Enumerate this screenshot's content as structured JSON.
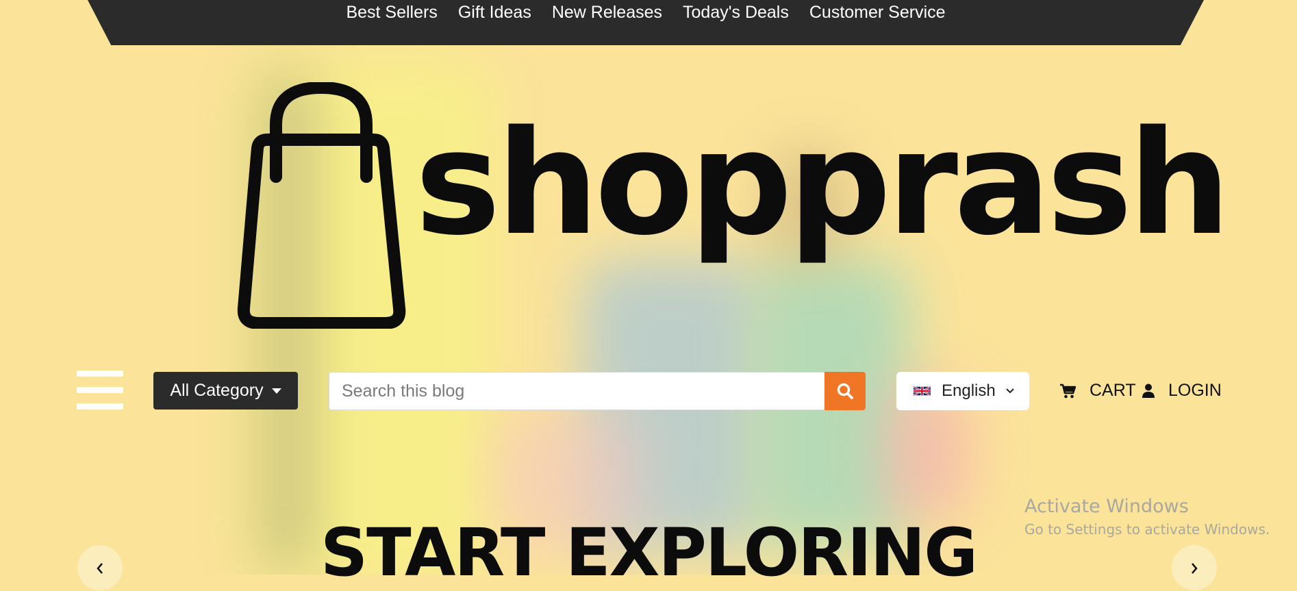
{
  "top_nav": {
    "items": [
      "Best Sellers",
      "Gift Ideas",
      "New Releases",
      "Today's Deals",
      "Customer Service"
    ]
  },
  "brand": {
    "logo_text": "shopprash"
  },
  "header": {
    "category_label": "All Category",
    "search_placeholder": "Search this blog",
    "language": "English",
    "cart_label": "CART",
    "login_label": "LOGIN"
  },
  "hero": {
    "title": "START EXPLORING"
  },
  "watermark": {
    "line1": "Activate Windows",
    "line2": "Go to Settings to activate Windows."
  },
  "colors": {
    "background": "#fbe39a",
    "nav_bg": "#2b2b2b",
    "accent": "#f07524"
  },
  "icons": [
    "menu-icon",
    "search-icon",
    "uk-flag-icon",
    "chevron-down-icon",
    "cart-icon",
    "user-icon",
    "chevron-left-icon",
    "chevron-right-icon"
  ]
}
